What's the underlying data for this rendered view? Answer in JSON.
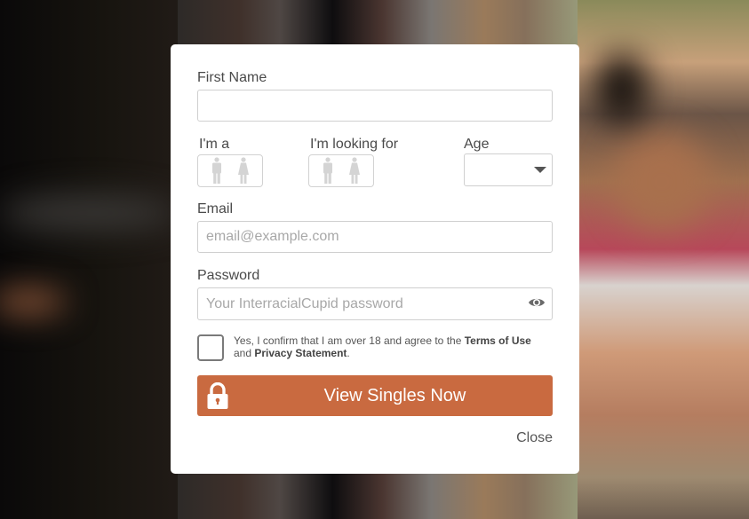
{
  "form": {
    "first_name": {
      "label": "First Name",
      "value": "",
      "placeholder": ""
    },
    "gender": {
      "label": "I'm a",
      "options": [
        {
          "name": "male",
          "icon": "male-icon"
        },
        {
          "name": "female",
          "icon": "female-icon"
        }
      ]
    },
    "looking_for": {
      "label": "I'm looking for",
      "options": [
        {
          "name": "male",
          "icon": "male-icon"
        },
        {
          "name": "female",
          "icon": "female-icon"
        }
      ]
    },
    "age": {
      "label": "Age",
      "selected": ""
    },
    "email": {
      "label": "Email",
      "value": "",
      "placeholder": "email@example.com"
    },
    "password": {
      "label": "Password",
      "value": "",
      "placeholder": "Your InterracialCupid password",
      "toggle_icon": "eye-icon"
    },
    "consent": {
      "checked": false,
      "text_before": "Yes, I confirm that I am over 18 and agree to the ",
      "terms_link": "Terms of Use",
      "text_and": " and ",
      "privacy_link": "Privacy Statement",
      "text_end": "."
    },
    "submit": {
      "label": "View Singles Now",
      "icon": "lock-icon",
      "color": "#c96a40"
    },
    "close_label": "Close"
  }
}
